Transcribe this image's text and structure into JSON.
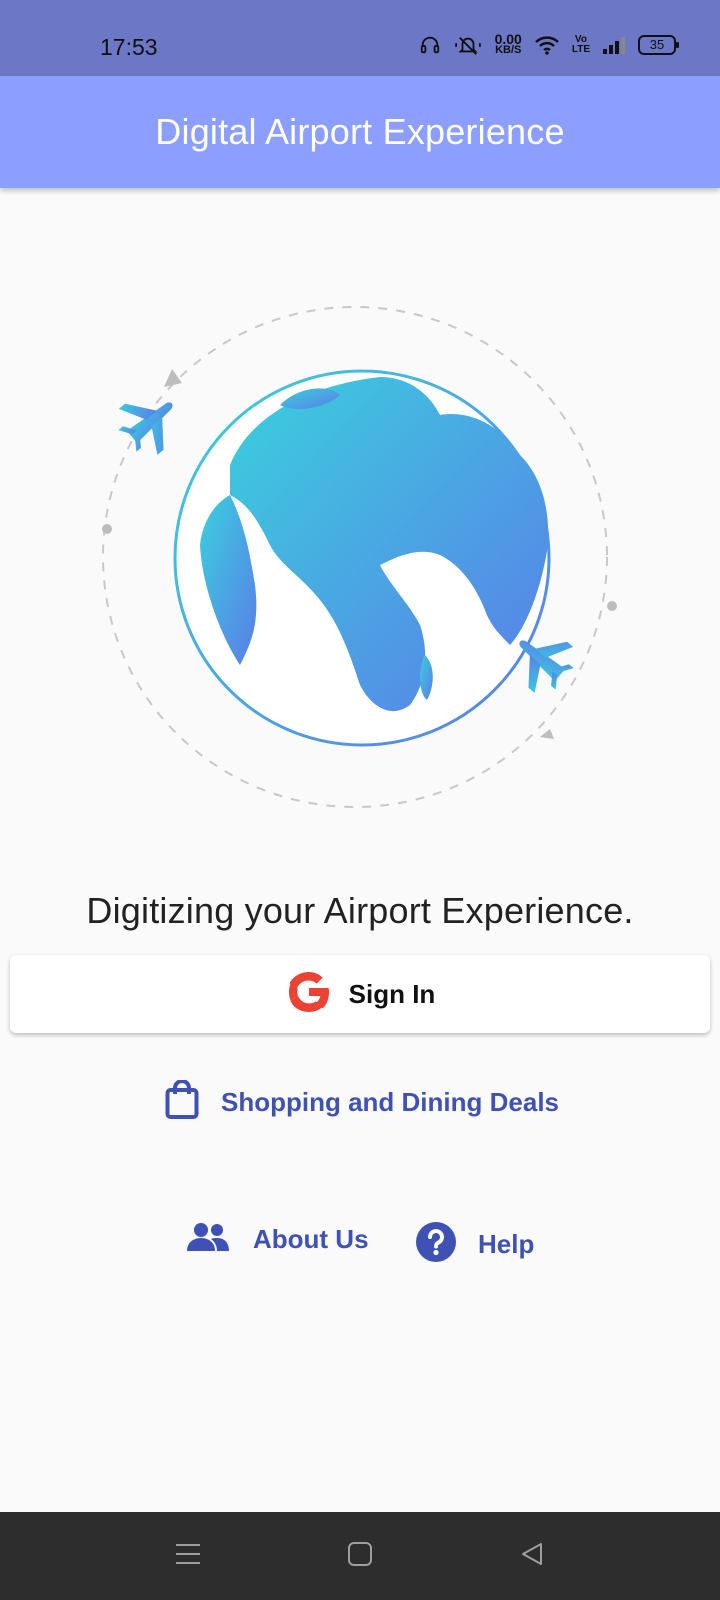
{
  "status_bar": {
    "time": "17:53",
    "net_speed_value": "0.00",
    "net_speed_unit": "KB/S",
    "volte_top": "Vo",
    "volte_bottom": "LTE",
    "battery": "35",
    "icons": [
      "headset-icon",
      "mute-icon",
      "wifi-icon",
      "volte-icon",
      "signal-icon",
      "battery-icon"
    ]
  },
  "app_bar": {
    "title": "Digital Airport Experience",
    "color": "#8c9eff"
  },
  "hero": {
    "icons": [
      "globe-illustration",
      "airplane-icon"
    ]
  },
  "tagline": "Digitizing your Airport Experience.",
  "signin": {
    "label": "Sign In",
    "icon": "google-icon"
  },
  "links": {
    "deals": {
      "label": "Shopping and Dining Deals",
      "icon": "shopping-bag-icon"
    },
    "about": {
      "label": "About Us",
      "icon": "people-icon"
    },
    "help": {
      "label": "Help",
      "icon": "help-icon"
    }
  },
  "colors": {
    "accent": "#3f51b5",
    "status_bar": "#6c78c6",
    "nav_bar": "#2d2d2d"
  },
  "nav_bar": {
    "icons": [
      "menu-icon",
      "home-icon",
      "back-icon"
    ]
  }
}
